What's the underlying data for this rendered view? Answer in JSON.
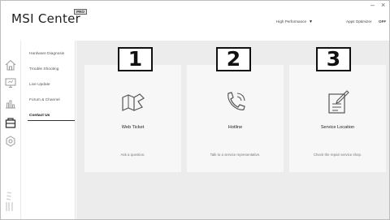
{
  "app": {
    "title": "MSI Center",
    "badge": "PRO"
  },
  "window_controls": {
    "minimize": "–",
    "close": "×"
  },
  "header": {
    "performance_mode": "High Performance",
    "dropdown_arrow": "▼",
    "apps_optimizer": "Apps Optimizer",
    "apps_optimizer_state": "OFF"
  },
  "icon_strip": [
    {
      "name": "home-icon"
    },
    {
      "name": "monitor-icon"
    },
    {
      "name": "chart-icon"
    },
    {
      "name": "support-icon"
    },
    {
      "name": "settings-icon"
    }
  ],
  "nav": {
    "items": [
      {
        "label": "Hardware Diagnosis"
      },
      {
        "label": "Trouble Shooting"
      },
      {
        "label": "Live Update"
      },
      {
        "label": "Forum & Channel"
      },
      {
        "label": "Contact Us",
        "active": true
      }
    ]
  },
  "cards": [
    {
      "title": "Web Ticket",
      "subtitle": "Ask a question.",
      "icon": "map-ticket-icon"
    },
    {
      "title": "Hotline",
      "subtitle": "Talk to a service representative.",
      "icon": "phone-icon"
    },
    {
      "title": "Service Location",
      "subtitle": "Check the repair service shop.",
      "icon": "document-edit-icon"
    }
  ],
  "annotations": [
    "1",
    "2",
    "3"
  ],
  "colors": {
    "content_bg": "#ececec",
    "card_bg": "#f7f7f7",
    "text_dark": "#222222",
    "text_muted": "#777777"
  }
}
